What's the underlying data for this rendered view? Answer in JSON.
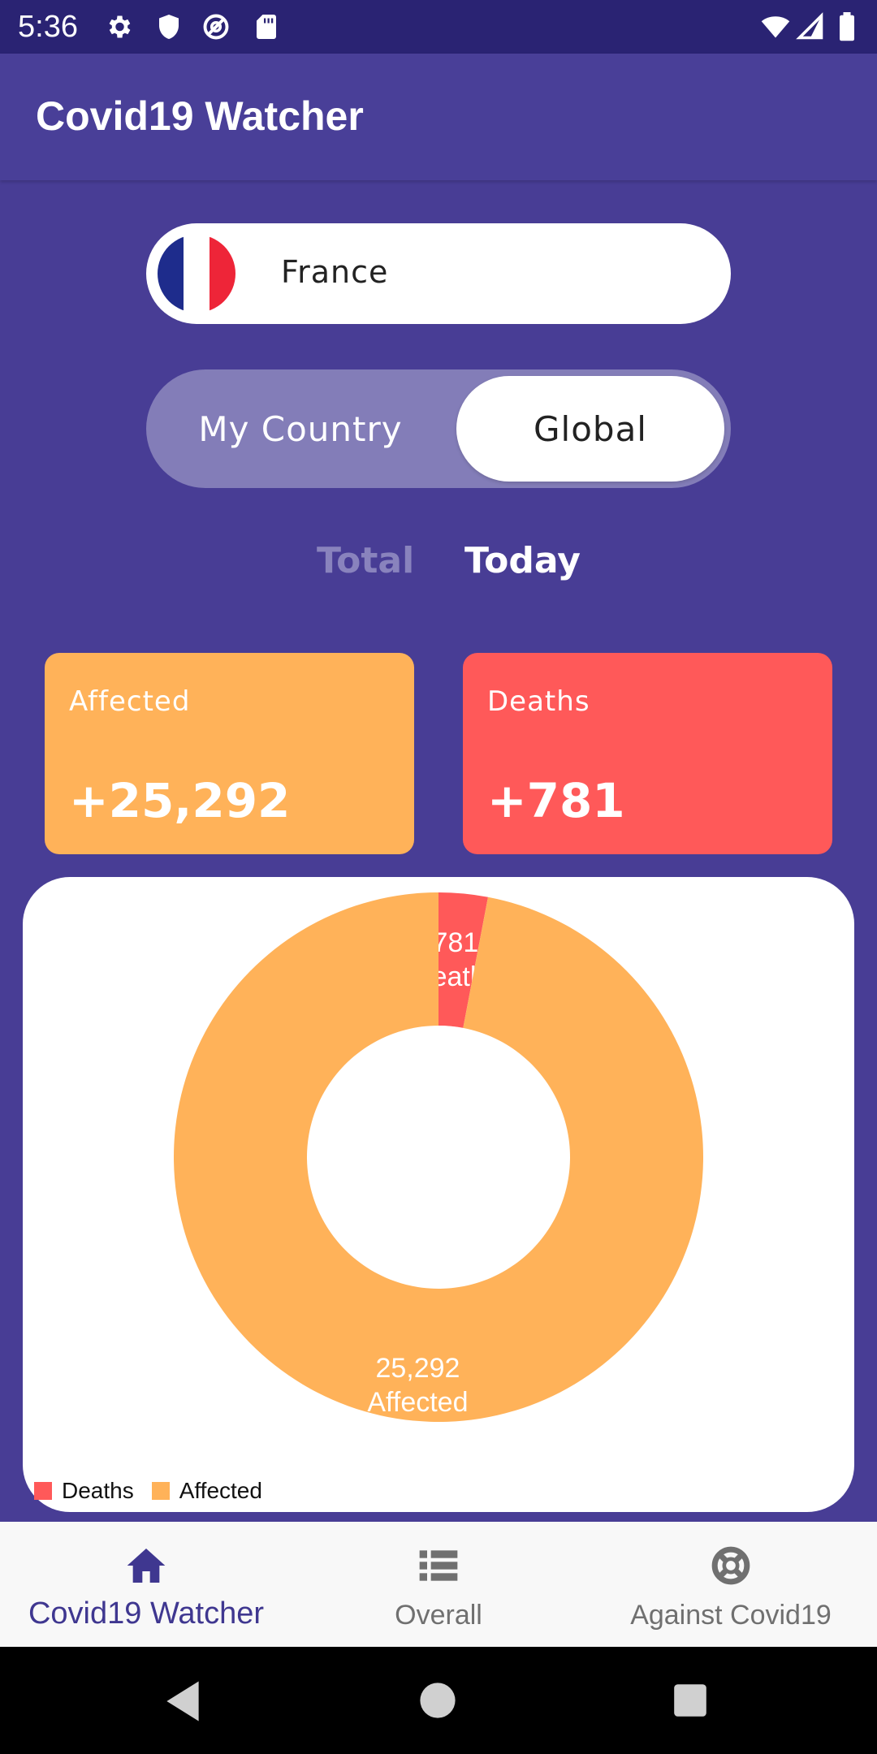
{
  "status_bar": {
    "time": "5:36",
    "icons_left": [
      "settings-icon",
      "shield-icon",
      "at-sign-icon",
      "sd-card-icon"
    ],
    "icons_right": [
      "wifi-icon",
      "signal-icon",
      "battery-icon"
    ]
  },
  "app_bar": {
    "title": "Covid19 Watcher"
  },
  "country_selector": {
    "flag": "france-flag-icon",
    "country": "France"
  },
  "toggle": {
    "left_label": "My Country",
    "right_label": "Global",
    "selected": "Global"
  },
  "tabs": {
    "total_label": "Total",
    "today_label": "Today",
    "selected": "Today"
  },
  "cards": {
    "affected": {
      "label": "Affected",
      "value": "+25,292"
    },
    "deaths": {
      "label": "Deaths",
      "value": "+781"
    }
  },
  "chart_data": {
    "type": "pie",
    "labels": [
      "Deaths",
      "Affected"
    ],
    "values": [
      781,
      25292
    ],
    "slice_labels": [
      {
        "value": "781",
        "name": "Deaths"
      },
      {
        "value": "25,292",
        "name": "Affected"
      }
    ],
    "colors": [
      "#FF5959",
      "#FFB259"
    ],
    "legend_placement": "bottom-left"
  },
  "bottom_nav": [
    {
      "label": "Covid19 Watcher",
      "icon": "home-icon",
      "active": true
    },
    {
      "label": "Overall",
      "icon": "list-icon",
      "active": false
    },
    {
      "label": "Against Covid19",
      "icon": "lifebuoy-icon",
      "active": false
    }
  ],
  "system_nav": [
    "back-icon",
    "home-circle-icon",
    "recents-icon"
  ],
  "colors": {
    "primary": "#483D95",
    "status_bar": "#2A2373",
    "affected": "#FFB259",
    "deaths": "#FF5959",
    "nav_active": "#3F3790"
  }
}
